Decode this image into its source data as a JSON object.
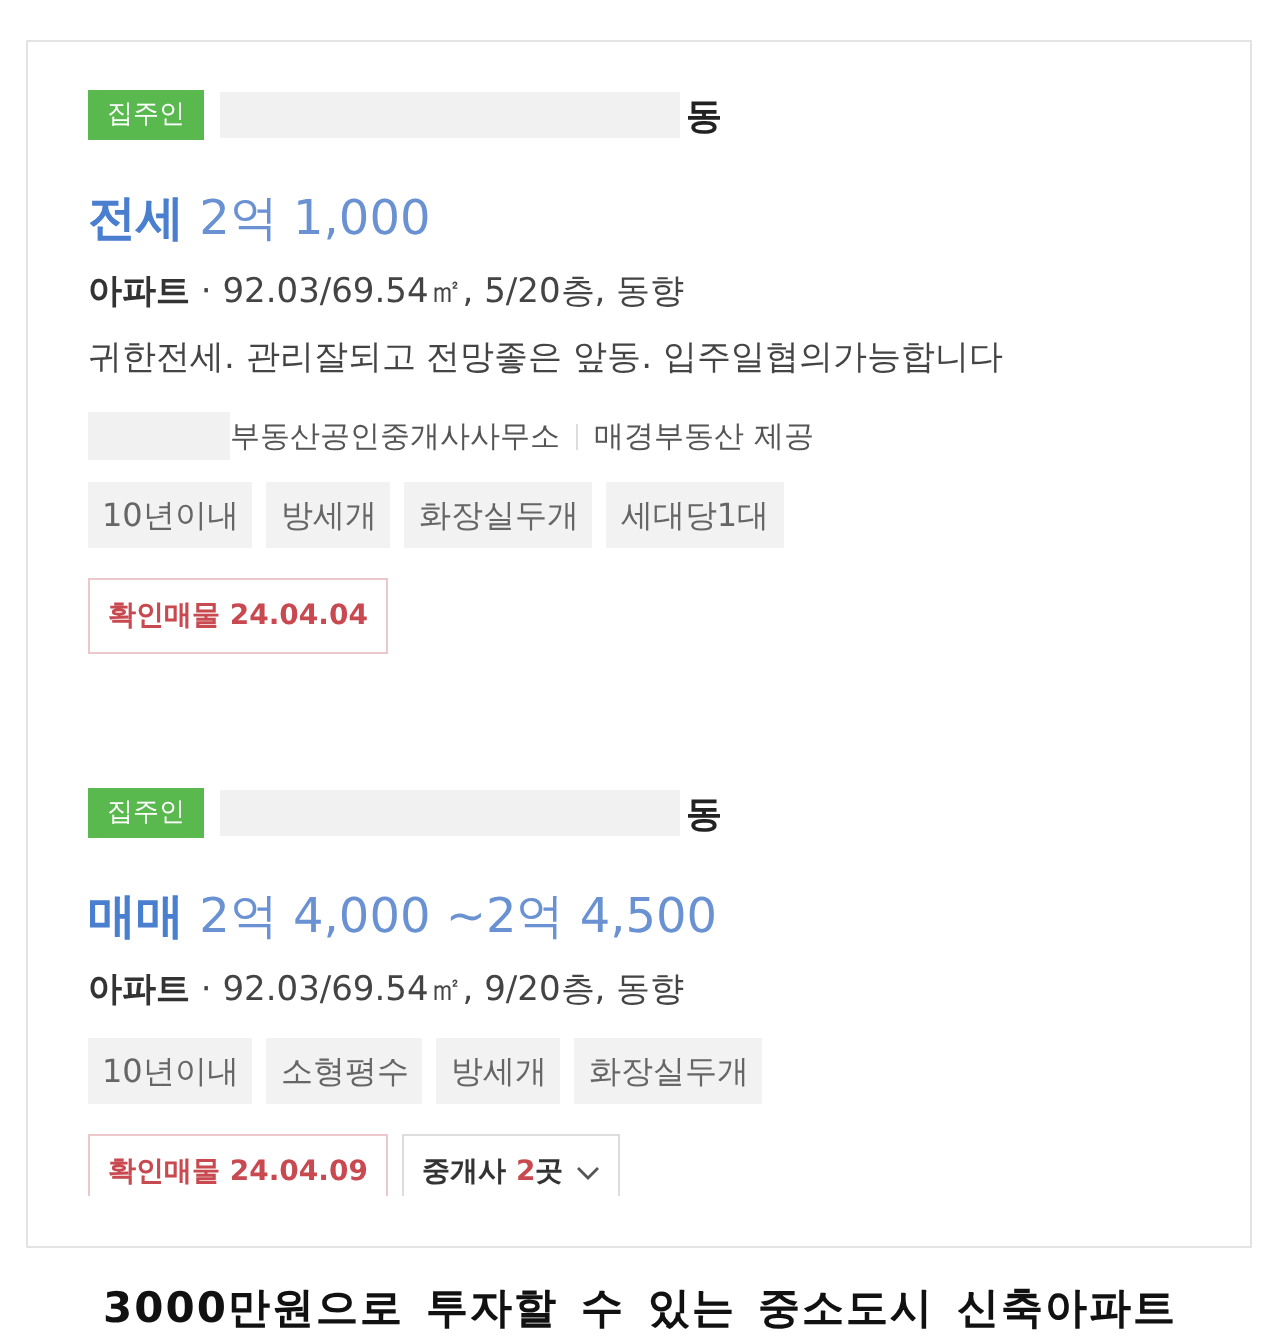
{
  "listings": [
    {
      "owner_badge": "집주인",
      "address_suffix": "동",
      "price": "**전세** 2억 1,000",
      "details": "**아파트** · 92.03/69.54㎡, 5/20층, 동향",
      "description": "귀한전세. 관리잘되고 전망좋은 앞동. 입주일협의가능합니다",
      "agency": "부동산공인중개사사무소",
      "provider": "매경부동산 제공",
      "tags": [
        "10년이내",
        "방세개",
        "화장실두개",
        "세대당1대"
      ],
      "verified": "확인매물 24.04.04"
    },
    {
      "owner_badge": "집주인",
      "address_suffix": "동",
      "price": "**매매** 2억 4,000 ~2억 4,500",
      "details": "**아파트** · 92.03/69.54㎡, 9/20층, 동향",
      "tags": [
        "10년이내",
        "소형평수",
        "방세개",
        "화장실두개"
      ],
      "verified": "확인매물 24.04.09",
      "agents_button": {
        "label": "중개사",
        "count": "2",
        "unit": "곳"
      }
    }
  ],
  "caption": "3000만원으로 투자할 수 있는 중소도시 신축아파트"
}
